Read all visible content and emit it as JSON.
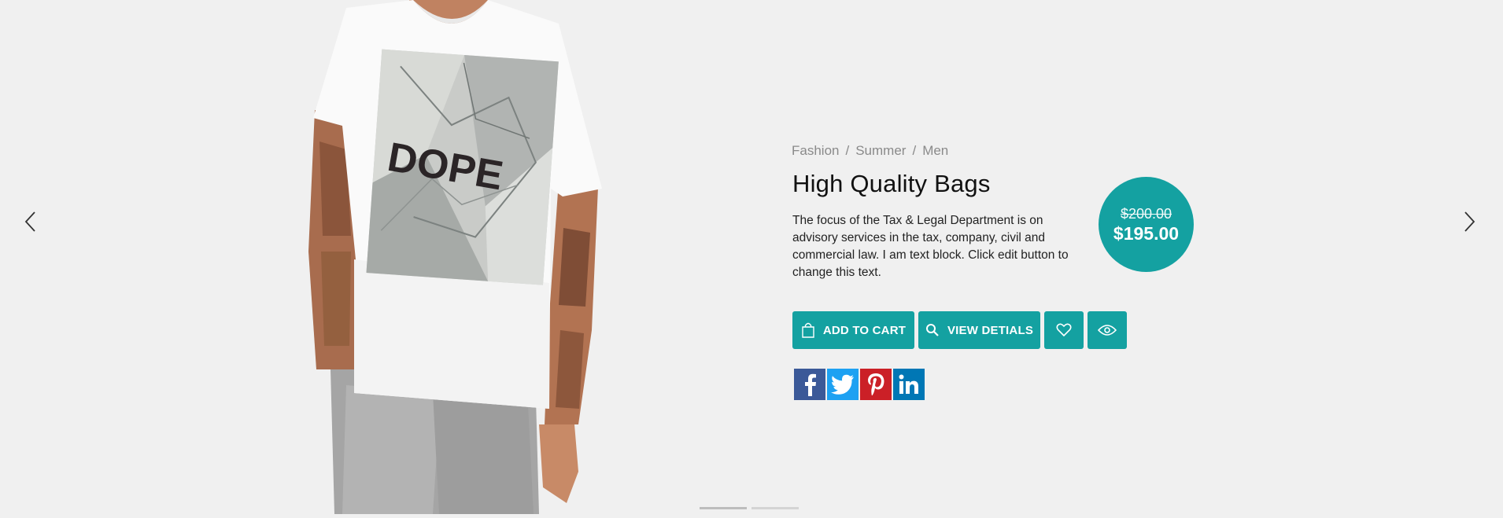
{
  "breadcrumb": [
    "Fashion",
    "Summer",
    "Men"
  ],
  "breadcrumb_separator": "/",
  "product": {
    "title": "High Quality Bags",
    "description": "The focus of the Tax & Legal Department is on advisory services in the tax, company, civil and commercial law. I am text block. Click edit button to change this text.",
    "price_old": "$200.00",
    "price_new": "$195.00",
    "shirt_print": "DOPE"
  },
  "buttons": {
    "add_to_cart": "ADD TO CART",
    "view_details": "VIEW DETIALS"
  },
  "icons": {
    "prev": "chevron-left-icon",
    "next": "chevron-right-icon",
    "cart": "shopping-bag-icon",
    "search": "search-icon",
    "wishlist": "heart-icon",
    "quick_view": "eye-icon",
    "social": [
      "facebook-icon",
      "twitter-icon",
      "pinterest-icon",
      "linkedin-icon"
    ]
  },
  "colors": {
    "accent": "#14a1a1",
    "background": "#f0f0f0",
    "facebook": "#3b5998",
    "twitter": "#1da1f2",
    "pinterest": "#cb2027",
    "linkedin": "#0077b5"
  },
  "slider": {
    "slides": 2,
    "active": 1
  }
}
